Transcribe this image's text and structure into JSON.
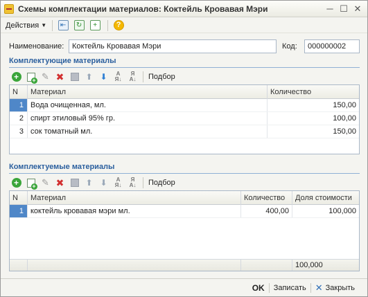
{
  "window": {
    "title": "Схемы комплектации материалов: Коктейль Кровавая Мэри",
    "minimize": "─",
    "maximize": "☐",
    "close": "✕"
  },
  "toolbar": {
    "actions_label": "Действия",
    "icons": [
      "back-icon",
      "refresh-icon",
      "copy-document-icon",
      "help-icon"
    ]
  },
  "form": {
    "name_label": "Наименование:",
    "name_value": "Коктейль Кровавая Мэри",
    "code_label": "Код:",
    "code_value": "000000002"
  },
  "components": {
    "title": "Комплектующие материалы",
    "pick_label": "Подбор",
    "columns": [
      "N",
      "Материал",
      "Количество"
    ],
    "rows": [
      {
        "n": "1",
        "material": "Вода очищенная, мл.",
        "quantity": "150,00"
      },
      {
        "n": "2",
        "material": "спирт этиловый 95% гр.",
        "quantity": "100,00"
      },
      {
        "n": "3",
        "material": "сок томатный мл.",
        "quantity": "150,00"
      }
    ]
  },
  "products": {
    "title": "Комплектуемые материалы",
    "pick_label": "Подбор",
    "columns": [
      "N",
      "Материал",
      "Количество",
      "Доля стоимости"
    ],
    "rows": [
      {
        "n": "1",
        "material": "коктейль кровавая мэри мл.",
        "quantity": "400,00",
        "share": "100,000"
      }
    ],
    "total_share": "100,000"
  },
  "footer": {
    "ok_label": "OK",
    "save_label": "Записать",
    "close_label": "Закрыть"
  },
  "colors": {
    "accent": "#2b5f9e",
    "selection": "#4f87c8",
    "add_green": "#3aa53a",
    "delete_red": "#d23030"
  }
}
